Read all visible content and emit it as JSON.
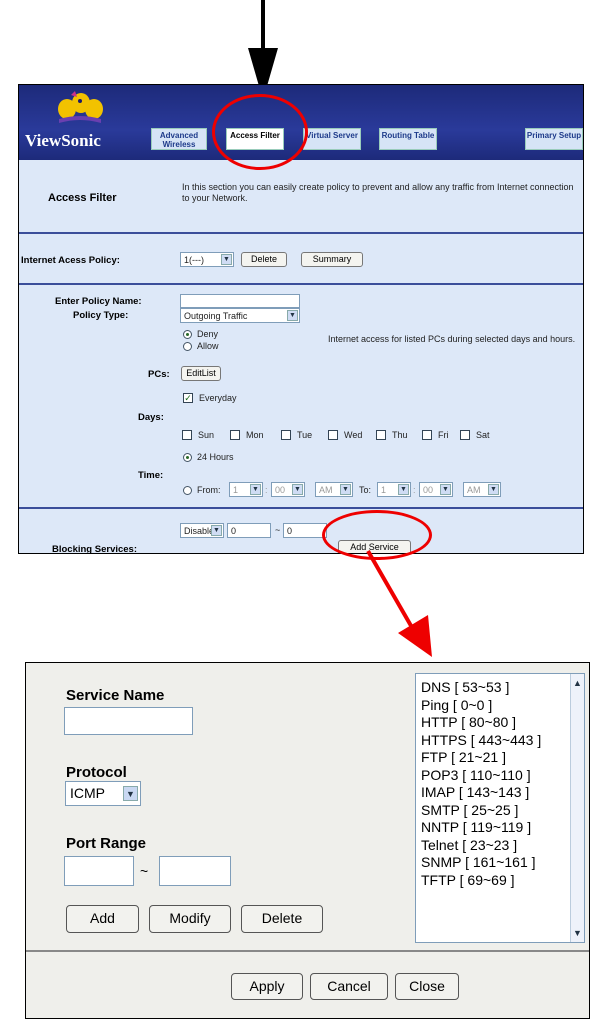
{
  "router": {
    "logo": "ViewSonic",
    "tabs": [
      "Advanced Wireless",
      "Access Filter",
      "Virtual Server",
      "Routing Table",
      "Primary Setup"
    ],
    "section_title": "Access Filter",
    "section_desc": "In this section you can easily create policy to prevent and allow any traffic from Internet connection to your Network.",
    "policy_label": "Internet Acess Policy:",
    "policy_select": "1(---)",
    "delete_btn": "Delete",
    "summary_btn": "Summary",
    "name_label": "Enter Policy Name:",
    "type_label": "Policy Type:",
    "type_select": "Outgoing Traffic",
    "deny": "Deny",
    "allow": "Allow",
    "deny_desc": "Internet access for listed PCs during selected days and hours.",
    "pcs_label": "PCs:",
    "editlist_btn": "EditList",
    "everyday": "Everyday",
    "days_label": "Days:",
    "days": [
      "Sun",
      "Mon",
      "Tue",
      "Wed",
      "Thu",
      "Fri",
      "Sat"
    ],
    "time_label": "Time:",
    "hours24": "24 Hours",
    "from": "From:",
    "to": "To:",
    "from_h": "1",
    "from_m": "00",
    "from_ap": "AM",
    "to_h": "1",
    "to_m": "00",
    "to_ap": "AM",
    "blocking_label": "Blocking Services:",
    "blocking_select": "Disable",
    "port_from": "0",
    "port_tilde": "~",
    "port_to": "0",
    "add_service_btn": "Add Service"
  },
  "service": {
    "name_label": "Service Name",
    "name_value": "",
    "protocol_label": "Protocol",
    "protocol_value": "ICMP",
    "port_label": "Port Range",
    "tilde": "~",
    "add_btn": "Add",
    "modify_btn": "Modify",
    "delete_btn": "Delete",
    "list": [
      "DNS [ 53~53 ]",
      "Ping [ 0~0 ]",
      "HTTP [ 80~80 ]",
      "HTTPS [ 443~443 ]",
      "FTP [ 21~21 ]",
      "POP3 [ 110~110 ]",
      "IMAP [ 143~143 ]",
      "SMTP [ 25~25 ]",
      "NNTP [ 119~119 ]",
      "Telnet [ 23~23 ]",
      "SNMP [ 161~161 ]",
      "TFTP [ 69~69 ]"
    ],
    "apply_btn": "Apply",
    "cancel_btn": "Cancel",
    "close_btn": "Close"
  },
  "colors": {
    "banner": "#1d2a7a",
    "callout": "#e00000",
    "panel_bg": "#dde8f8"
  }
}
